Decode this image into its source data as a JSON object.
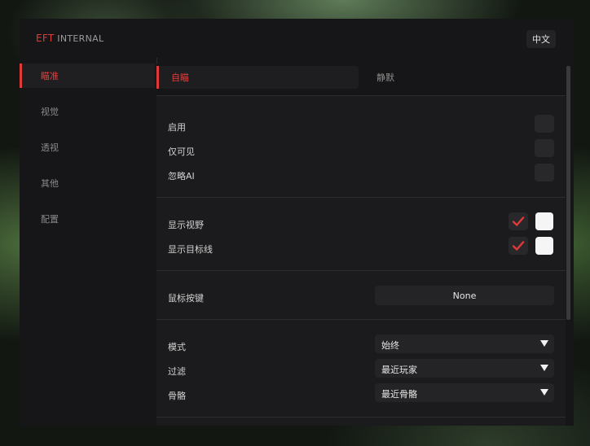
{
  "window": {
    "title_accent": "EFT",
    "title_rest": " INTERNAL",
    "lang_button": "中文"
  },
  "sidebar": {
    "items": [
      {
        "label": "瞄准",
        "active": true
      },
      {
        "label": "视觉",
        "active": false
      },
      {
        "label": "透视",
        "active": false
      },
      {
        "label": "其他",
        "active": false
      },
      {
        "label": "配置",
        "active": false
      }
    ]
  },
  "tabs": [
    {
      "label": "自瞄",
      "active": true
    },
    {
      "label": "静默",
      "active": false
    }
  ],
  "settings": {
    "enable_label": "启用",
    "visible_only_label": "仅可见",
    "ignore_ai_label": "忽略AI",
    "show_fov_label": "显示视野",
    "show_fov_checked": true,
    "show_target_line_label": "显示目标线",
    "show_target_line_checked": true,
    "mouse_key_label": "鼠标按键",
    "mouse_key_value": "None",
    "mode_label": "模式",
    "mode_value": "始终",
    "filter_label": "过滤",
    "filter_value": "最近玩家",
    "bone_label": "骨骼",
    "bone_value": "最近骨骼"
  },
  "colors": {
    "accent": "#e03a3a",
    "color_swatch": "#f5f5f5"
  }
}
